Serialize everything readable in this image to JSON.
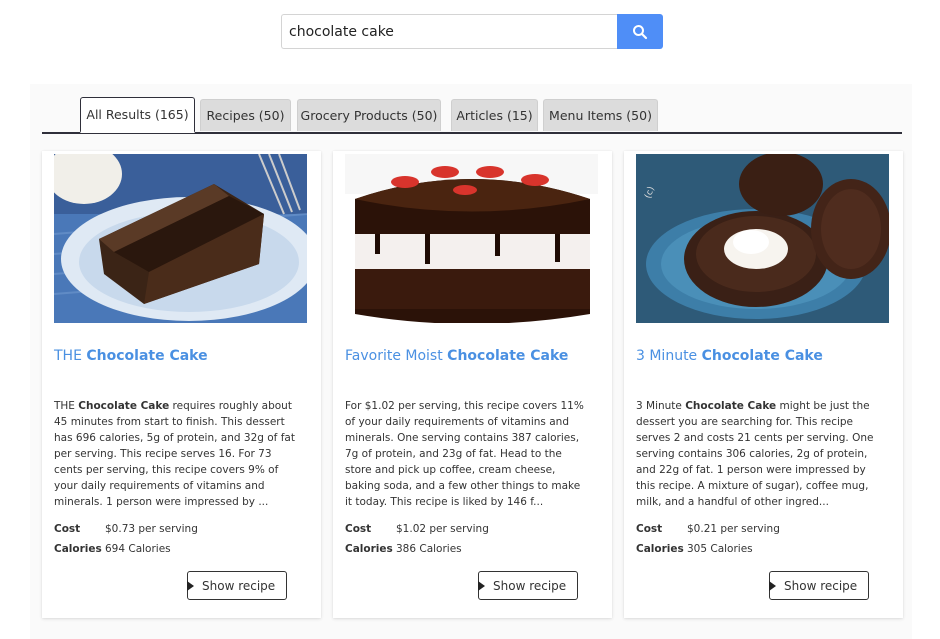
{
  "search": {
    "value": "chocolate cake",
    "button_icon": "search-icon",
    "accent": "#4f8ef7"
  },
  "tabs": [
    {
      "label": "All Results (165)",
      "active": true
    },
    {
      "label": "Recipes (50)",
      "active": false
    },
    {
      "label": "Grocery Products (50)",
      "active": false
    },
    {
      "label": "Articles (15)",
      "active": false
    },
    {
      "label": "Menu Items (50)",
      "active": false
    }
  ],
  "cards": [
    {
      "title_pre": "THE ",
      "title_bold": "Chocolate Cake",
      "desc_pre": "THE ",
      "desc_bold": "Chocolate Cake",
      "desc_rest": " requires roughly about 45 minutes from start to finish. This dessert has 696 calories, 5g of protein, and 32g of fat per serving. This recipe serves 16. For 73 cents per serving, this recipe covers 9% of your daily requirements of vitamins and minerals. 1 person were impressed by ...",
      "cost_label": "Cost",
      "cost_value": "$0.73 per serving",
      "calories_label": "Calories",
      "calories_value": "694 Calories",
      "button": "Show recipe"
    },
    {
      "title_pre": "Favorite Moist ",
      "title_bold": "Chocolate Cake",
      "desc_pre": "For $1.02 per serving, this recipe covers 11% of your daily requirements of vitamins and minerals. One serving contains 387 calories, 7g of protein, and 23g of fat. Head to the store and pick up coffee, cream cheese, baking soda, and a few other things to make it today. This recipe is liked by 146 f...",
      "desc_bold": "",
      "desc_rest": "",
      "cost_label": "Cost",
      "cost_value": "$1.02 per serving",
      "calories_label": "Calories",
      "calories_value": "386 Calories",
      "button": "Show recipe"
    },
    {
      "title_pre": "3 Minute ",
      "title_bold": "Chocolate Cake",
      "desc_pre": "3 Minute ",
      "desc_bold": "Chocolate Cake",
      "desc_rest": " might be just the dessert you are searching for. This recipe serves 2 and costs 21 cents per serving. One serving contains 306 calories, 2g of protein, and 22g of fat. 1 person were impressed by this recipe. A mixture of sugar), coffee mug, milk, and a handful of other ingred...",
      "cost_label": "Cost",
      "cost_value": "$0.21 per serving",
      "calories_label": "Calories",
      "calories_value": "305 Calories",
      "button": "Show recipe"
    }
  ],
  "colors": {
    "link": "#4a90e2",
    "tab_inactive": "#dcdcdc",
    "tab_border": "#2f2f3a"
  }
}
